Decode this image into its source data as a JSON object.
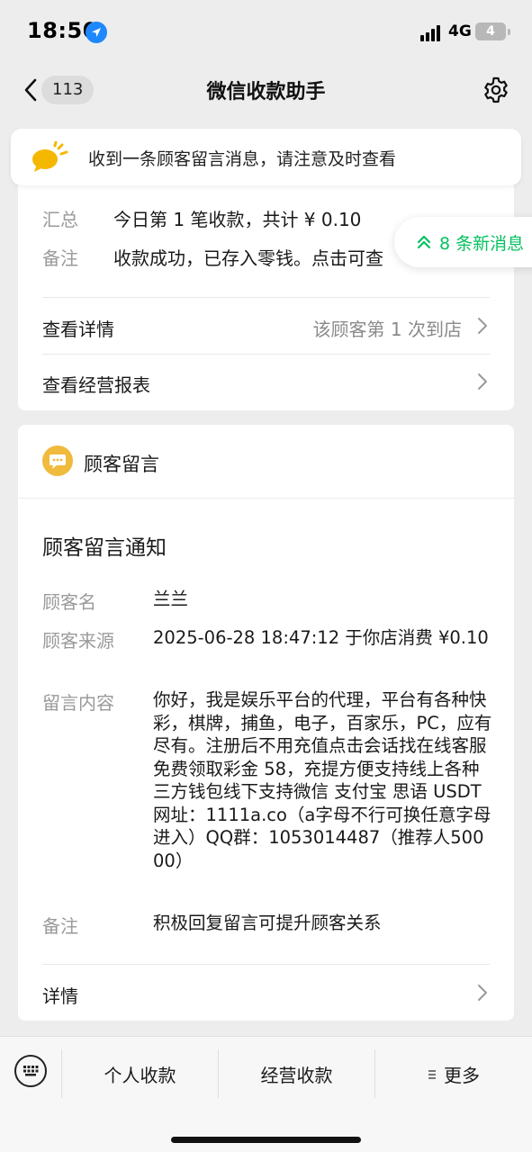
{
  "status_bar": {
    "time": "18:50",
    "network": "4G",
    "battery": "4"
  },
  "nav": {
    "back_count": "113",
    "title": "微信收款助手"
  },
  "notice": {
    "text": "收到一条顾客留言消息，请注意及时查看"
  },
  "payment_card": {
    "summary_label": "汇总",
    "summary_value": "今日第 1 笔收款，共计 ¥ 0.10",
    "remark_label": "备注",
    "remark_value": "收款成功，已存入零钱。点击可查",
    "details_label": "查看详情",
    "details_value": "该顾客第 1 次到店",
    "report_label": "查看经营报表"
  },
  "new_messages": {
    "text": "8 条新消息"
  },
  "message_card": {
    "section_title": "顾客留言",
    "notice_title": "顾客留言通知",
    "customer_name_label": "顾客名",
    "customer_name": "兰兰",
    "source_label": "顾客来源",
    "source_value": "2025-06-28 18:47:12 于你店消费 ¥0.10",
    "content_label": "留言内容",
    "content_value": "你好，我是娱乐平台的代理，平台有各种快彩，棋牌，捕鱼，电子，百家乐，PC，应有尽有。注册后不用充值点击会话找在线客服免费领取彩金 58，充提方便支持线上各种三方钱包线下支持微信 支付宝 思语 USDT网址：1111a.co（a字母不行可换任意字母进入）QQ群：1053014487（推荐人50000）",
    "remark_label": "备注",
    "remark_value": "积极回复留言可提升顾客关系",
    "details_label": "详情"
  },
  "bottom_menu": {
    "items": [
      "个人收款",
      "经营收款",
      "更多"
    ]
  },
  "colors": {
    "accent_green": "#07c160",
    "section_icon": "#f0bb3d",
    "location_blue": "#1e88ff"
  }
}
